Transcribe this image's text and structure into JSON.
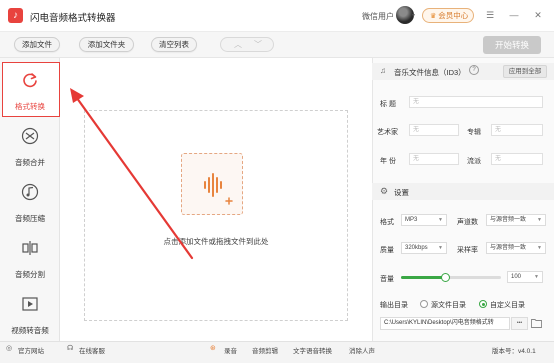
{
  "app": {
    "title": "闪电音频格式转换器",
    "user_label": "微信用户",
    "vip_label": "会员中心"
  },
  "toolbar": {
    "add_file": "添加文件",
    "add_folder": "添加文件夹",
    "clear_list": "清空列表",
    "start_convert": "开始转换"
  },
  "sidebar": {
    "items": [
      {
        "label": "格式转换",
        "icon": "refresh-icon"
      },
      {
        "label": "音频合并",
        "icon": "merge-icon"
      },
      {
        "label": "音频压缩",
        "icon": "music-note-icon"
      },
      {
        "label": "音频分割",
        "icon": "split-icon"
      },
      {
        "label": "视频转音频",
        "icon": "video-play-icon"
      }
    ]
  },
  "main": {
    "drop_hint": "点击添加文件或拖拽文件到此处"
  },
  "id3": {
    "title": "音乐文件信息（ID3）",
    "apply_all": "应用到全部",
    "fields": {
      "title_label": "标  题",
      "artist_label": "艺术家",
      "album_label": "专辑",
      "year_label": "年  份",
      "genre_label": "流派",
      "empty": "无"
    }
  },
  "settings": {
    "title": "设置",
    "format_label": "格式",
    "format_value": "MP3",
    "channel_label": "声道数",
    "channel_value": "与源音频一致",
    "quality_label": "质量",
    "quality_value": "320kbps",
    "samplerate_label": "采样率",
    "samplerate_value": "与源音频一致",
    "volume_label": "音量",
    "volume_value": "100",
    "volume_level": 0.44,
    "output_label": "输出目录",
    "output_source": "源文件目录",
    "output_custom": "自定义目录",
    "output_path": "C:\\Users\\KYLIN\\Desktop\\闪电音频格式转",
    "more": "•••"
  },
  "statusbar": {
    "website": "官方网站",
    "support": "在线客服",
    "tools": [
      "录音",
      "音频剪辑",
      "文字语音转换",
      "消除人声"
    ],
    "version": "版本号：v4.0.1"
  },
  "colors": {
    "accent": "#e8433e",
    "slider": "#3aa745",
    "vip": "#e5892e"
  }
}
